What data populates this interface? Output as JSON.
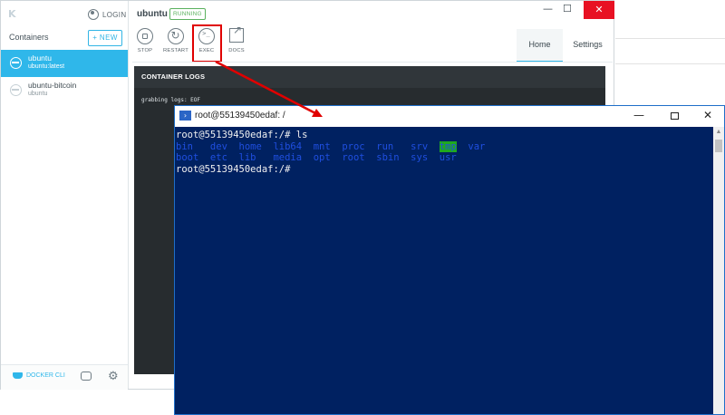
{
  "kitematic": {
    "login_label": "LOGIN",
    "containers_title": "Containers",
    "new_button": "+ NEW",
    "containers": [
      {
        "name": "ubuntu",
        "image": "ubuntu:latest",
        "active": true
      },
      {
        "name": "ubuntu-bitcoin",
        "image": "ubuntu",
        "active": false
      }
    ],
    "footer": {
      "cli_label": "DOCKER CLI"
    },
    "header": {
      "title": "ubuntu",
      "status": "RUNNING"
    },
    "toolbar": {
      "stop": "STOP",
      "restart": "RESTART",
      "exec": "EXEC",
      "docs": "DOCS"
    },
    "tabs": {
      "home": "Home",
      "settings": "Settings"
    },
    "logs": {
      "header": "CONTAINER LOGS",
      "text": "grabbing logs: EOF"
    },
    "window_controls": {
      "minimize": "—",
      "maximize": "☐",
      "close": "✕"
    }
  },
  "terminal": {
    "title": "root@55139450edaf: /",
    "controls": {
      "minimize": "—",
      "close": "✕"
    },
    "lines": {
      "cmd": "root@55139450edaf:/# ls",
      "row1_a": "bin   dev  home  lib64  mnt  proc  run   srv  ",
      "row1_hl": "tmp",
      "row1_b": "  var",
      "row2": "boot  etc  lib   media  opt  root  sbin  sys  usr",
      "prompt": "root@55139450edaf:/#"
    }
  },
  "colors": {
    "accent": "#2fb7ea",
    "running": "#5ab15e",
    "highlight_box": "#e00000",
    "terminal_bg": "#002161",
    "close_red": "#e81123"
  }
}
